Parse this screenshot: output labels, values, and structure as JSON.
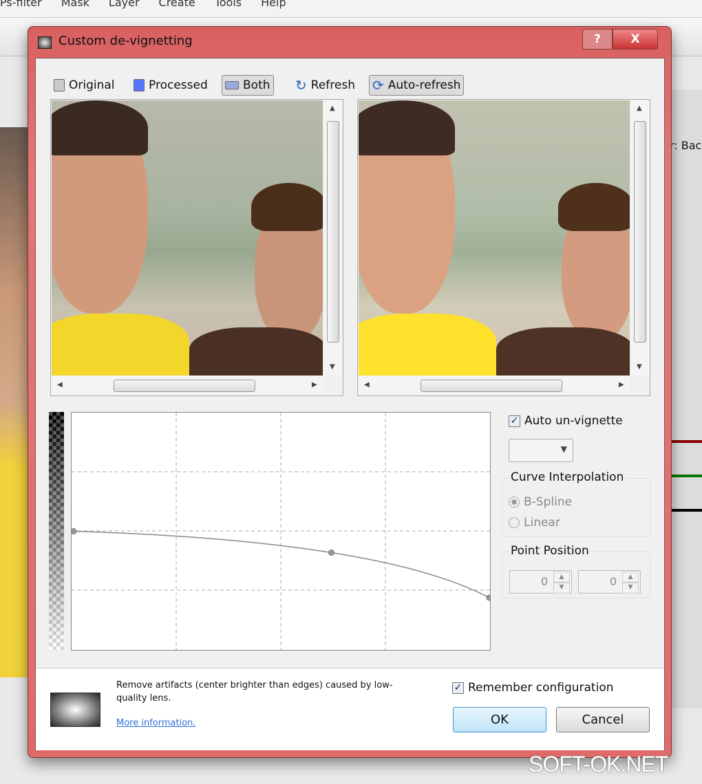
{
  "app_menu": [
    "Ps-filter",
    "Mask",
    "Layer",
    "Create",
    "Tools",
    "Help"
  ],
  "background_label": "r: Bac",
  "dialog": {
    "title": "Custom de-vignetting",
    "help_label": "?",
    "close_label": "X",
    "toolbar": {
      "original": "Original",
      "processed": "Processed",
      "both": "Both",
      "refresh": "Refresh",
      "auto_refresh": "Auto-refresh"
    },
    "auto_unvignette": {
      "label": "Auto un-vignette",
      "checked": true
    },
    "dropdown": {
      "value": ""
    },
    "curve_interpolation": {
      "title": "Curve Interpolation",
      "options": [
        "B-Spline",
        "Linear"
      ],
      "selected": "B-Spline"
    },
    "point_position": {
      "title": "Point Position",
      "x": "0",
      "y": "0"
    },
    "curve": {
      "points": [
        [
          0,
          0.5
        ],
        [
          0.62,
          0.41
        ],
        [
          1,
          0.22
        ]
      ]
    },
    "description": "Remove artifacts (center brighter than edges) caused by low-quality lens.",
    "more_info": "More information.",
    "remember": {
      "label": "Remember configuration",
      "checked": true
    },
    "ok": "OK",
    "cancel": "Cancel"
  },
  "watermark": "SOFT-OK.NET"
}
